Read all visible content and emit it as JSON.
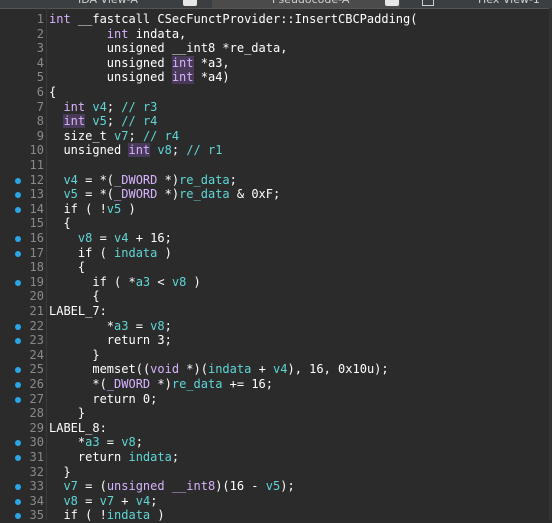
{
  "tabs": [
    {
      "label": "IDA View-A",
      "active": false
    },
    {
      "label": "Pseudocode-A",
      "active": true
    },
    {
      "label": "Hex View-1",
      "active": false
    }
  ],
  "colors": {
    "background": "#2b2b2b",
    "keyword": "#d7b3ff",
    "identifier": "#5fd7d7",
    "breakpoint": "#2aa6e8",
    "line_number": "#8a8a8a"
  },
  "lines": [
    {
      "n": "1",
      "bp": false,
      "segs": [
        [
          "kw",
          "int"
        ],
        [
          "t",
          " __fastcall CSecFunctProvider::InsertCBCPadding("
        ]
      ]
    },
    {
      "n": "2",
      "bp": false,
      "segs": [
        [
          "t",
          "        "
        ],
        [
          "kw",
          "int"
        ],
        [
          "t",
          " indata,"
        ]
      ]
    },
    {
      "n": "3",
      "bp": false,
      "segs": [
        [
          "t",
          "        unsigned __int8 *re_data,"
        ]
      ]
    },
    {
      "n": "4",
      "bp": false,
      "segs": [
        [
          "t",
          "        unsigned "
        ],
        [
          "hl",
          "int"
        ],
        [
          "t",
          " *a3,"
        ]
      ]
    },
    {
      "n": "5",
      "bp": false,
      "segs": [
        [
          "t",
          "        unsigned "
        ],
        [
          "hl",
          "int"
        ],
        [
          "t",
          " *a4)"
        ]
      ]
    },
    {
      "n": "6",
      "bp": false,
      "segs": [
        [
          "t",
          "{"
        ]
      ]
    },
    {
      "n": "7",
      "bp": false,
      "segs": [
        [
          "t",
          "  "
        ],
        [
          "kw",
          "int"
        ],
        [
          "cy",
          " v4"
        ],
        [
          "t",
          "; "
        ],
        [
          "cm",
          "// r3"
        ]
      ]
    },
    {
      "n": "8",
      "bp": false,
      "segs": [
        [
          "t",
          "  "
        ],
        [
          "hl",
          "int"
        ],
        [
          "cy",
          " v5"
        ],
        [
          "t",
          "; "
        ],
        [
          "cm",
          "// r4"
        ]
      ]
    },
    {
      "n": "9",
      "bp": false,
      "segs": [
        [
          "t",
          "  size_t "
        ],
        [
          "cy",
          "v7"
        ],
        [
          "t",
          "; "
        ],
        [
          "cm",
          "// r4"
        ]
      ]
    },
    {
      "n": "10",
      "bp": false,
      "segs": [
        [
          "t",
          "  unsigned "
        ],
        [
          "hl",
          "int"
        ],
        [
          "cy",
          " v8"
        ],
        [
          "t",
          "; "
        ],
        [
          "cm",
          "// r1"
        ]
      ]
    },
    {
      "n": "11",
      "bp": false,
      "segs": [
        [
          "t",
          ""
        ]
      ]
    },
    {
      "n": "12",
      "bp": true,
      "segs": [
        [
          "t",
          "  "
        ],
        [
          "cy",
          "v4"
        ],
        [
          "t",
          " = *("
        ],
        [
          "kw",
          "_DWORD"
        ],
        [
          "t",
          " *)"
        ],
        [
          "cy",
          "re_data"
        ],
        [
          "t",
          ";"
        ]
      ]
    },
    {
      "n": "13",
      "bp": true,
      "segs": [
        [
          "t",
          "  "
        ],
        [
          "cy",
          "v5"
        ],
        [
          "t",
          " = *("
        ],
        [
          "kw",
          "_DWORD"
        ],
        [
          "t",
          " *)"
        ],
        [
          "cy",
          "re_data"
        ],
        [
          "t",
          " & 0xF;"
        ]
      ]
    },
    {
      "n": "14",
      "bp": true,
      "segs": [
        [
          "t",
          "  if ( !"
        ],
        [
          "cy",
          "v5"
        ],
        [
          "t",
          " )"
        ]
      ]
    },
    {
      "n": "15",
      "bp": false,
      "segs": [
        [
          "t",
          "  {"
        ]
      ]
    },
    {
      "n": "16",
      "bp": true,
      "segs": [
        [
          "t",
          "    "
        ],
        [
          "cy",
          "v8"
        ],
        [
          "t",
          " = "
        ],
        [
          "cy",
          "v4"
        ],
        [
          "t",
          " + 16;"
        ]
      ]
    },
    {
      "n": "17",
      "bp": true,
      "segs": [
        [
          "t",
          "    if ( "
        ],
        [
          "cy",
          "indata"
        ],
        [
          "t",
          " )"
        ]
      ]
    },
    {
      "n": "18",
      "bp": false,
      "segs": [
        [
          "t",
          "    {"
        ]
      ]
    },
    {
      "n": "19",
      "bp": true,
      "segs": [
        [
          "t",
          "      if ( *"
        ],
        [
          "cy",
          "a3"
        ],
        [
          "t",
          " < "
        ],
        [
          "cy",
          "v8"
        ],
        [
          "t",
          " )"
        ]
      ]
    },
    {
      "n": "20",
      "bp": false,
      "segs": [
        [
          "t",
          "      {"
        ]
      ]
    },
    {
      "n": "21",
      "bp": false,
      "segs": [
        [
          "t",
          "LABEL_7:"
        ]
      ]
    },
    {
      "n": "22",
      "bp": true,
      "segs": [
        [
          "t",
          "        *"
        ],
        [
          "cy",
          "a3"
        ],
        [
          "t",
          " = "
        ],
        [
          "cy",
          "v8"
        ],
        [
          "t",
          ";"
        ]
      ]
    },
    {
      "n": "23",
      "bp": true,
      "segs": [
        [
          "t",
          "        return 3;"
        ]
      ]
    },
    {
      "n": "24",
      "bp": false,
      "segs": [
        [
          "t",
          "      }"
        ]
      ]
    },
    {
      "n": "25",
      "bp": true,
      "segs": [
        [
          "t",
          "      "
        ],
        [
          "fn",
          "memset"
        ],
        [
          "t",
          "(("
        ],
        [
          "kw",
          "void"
        ],
        [
          "t",
          " *)("
        ],
        [
          "cy",
          "indata"
        ],
        [
          "t",
          " + "
        ],
        [
          "cy",
          "v4"
        ],
        [
          "t",
          "), 16, 0x10u);"
        ]
      ]
    },
    {
      "n": "26",
      "bp": true,
      "segs": [
        [
          "t",
          "      *("
        ],
        [
          "kw",
          "_DWORD"
        ],
        [
          "t",
          " *)"
        ],
        [
          "cy",
          "re_data"
        ],
        [
          "t",
          " += 16;"
        ]
      ]
    },
    {
      "n": "27",
      "bp": true,
      "segs": [
        [
          "t",
          "      return 0;"
        ]
      ]
    },
    {
      "n": "28",
      "bp": false,
      "segs": [
        [
          "t",
          "    }"
        ]
      ]
    },
    {
      "n": "29",
      "bp": false,
      "segs": [
        [
          "t",
          "LABEL_8:"
        ]
      ]
    },
    {
      "n": "30",
      "bp": true,
      "segs": [
        [
          "t",
          "    *"
        ],
        [
          "cy",
          "a3"
        ],
        [
          "t",
          " = "
        ],
        [
          "cy",
          "v8"
        ],
        [
          "t",
          ";"
        ]
      ]
    },
    {
      "n": "31",
      "bp": true,
      "segs": [
        [
          "t",
          "    return "
        ],
        [
          "cy",
          "indata"
        ],
        [
          "t",
          ";"
        ]
      ]
    },
    {
      "n": "32",
      "bp": false,
      "segs": [
        [
          "t",
          "  }"
        ]
      ]
    },
    {
      "n": "33",
      "bp": true,
      "segs": [
        [
          "t",
          "  "
        ],
        [
          "cy",
          "v7"
        ],
        [
          "t",
          " = ("
        ],
        [
          "kw",
          "unsigned __int8"
        ],
        [
          "t",
          ")(16 - "
        ],
        [
          "cy",
          "v5"
        ],
        [
          "t",
          ");"
        ]
      ]
    },
    {
      "n": "34",
      "bp": true,
      "segs": [
        [
          "t",
          "  "
        ],
        [
          "cy",
          "v8"
        ],
        [
          "t",
          " = "
        ],
        [
          "cy",
          "v7"
        ],
        [
          "t",
          " + "
        ],
        [
          "cy",
          "v4"
        ],
        [
          "t",
          ";"
        ]
      ]
    },
    {
      "n": "35",
      "bp": true,
      "segs": [
        [
          "t",
          "  if ( !"
        ],
        [
          "cy",
          "indata"
        ],
        [
          "t",
          " )"
        ]
      ]
    }
  ]
}
